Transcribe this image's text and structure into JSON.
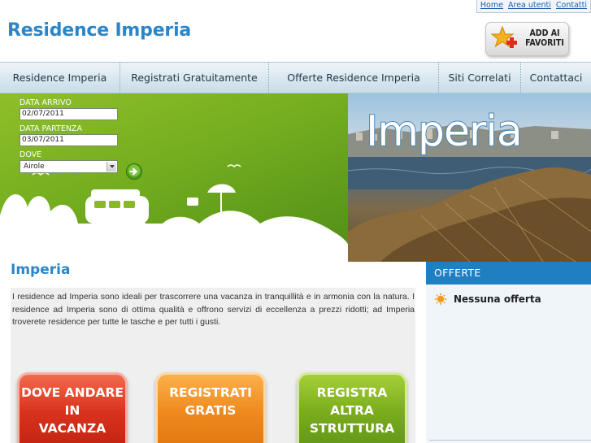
{
  "header": {
    "site_title": "Residence Imperia",
    "top_links": [
      "Home",
      "Area utenti",
      "Contatti"
    ],
    "favorites_line1": "ADD AI",
    "favorites_line2": "FAVORITI"
  },
  "nav": {
    "items": [
      "Residence Imperia",
      "Registrati Gratuitamente",
      "Offerte Residence Imperia",
      "Siti Correlati",
      "Contattaci"
    ]
  },
  "search": {
    "arrival_label": "DATA ARRIVO",
    "arrival_value": "02/07/2011",
    "departure_label": "DATA PARTENZA",
    "departure_value": "03/07/2011",
    "where_label": "DOVE",
    "where_value": "Airole"
  },
  "banner": {
    "photo_title": "Imperia"
  },
  "main": {
    "title": "Imperia",
    "description": "I residence ad Imperia sono ideali per trascorrere una vacanza in tranquillità e in armonia con la natura. I residence ad Imperia sono di ottima qualità e offrono servizi di eccellenza a prezzi ridotti; ad Imperia troverete residence per tutte le tasche e per tutti i gusti.",
    "cta": [
      {
        "line1": "DOVE ANDARE",
        "line2": "IN",
        "line3": "VACANZA",
        "color": "#d9321c"
      },
      {
        "line1": "REGISTRATI",
        "line2": "GRATIS",
        "line3": "",
        "color": "#ef8a1f"
      },
      {
        "line1": "REGISTRA",
        "line2": "ALTRA",
        "line3": "STRUTTURA",
        "color": "#79ad1c"
      }
    ]
  },
  "sidebar": {
    "header": "OFFERTE",
    "empty_offer": "Nessuna offerta",
    "accent": "#1f7fc0"
  },
  "icons": [
    "add-favorite-icon",
    "go-arrow-icon",
    "select-arrow-icon",
    "sun-icon"
  ]
}
